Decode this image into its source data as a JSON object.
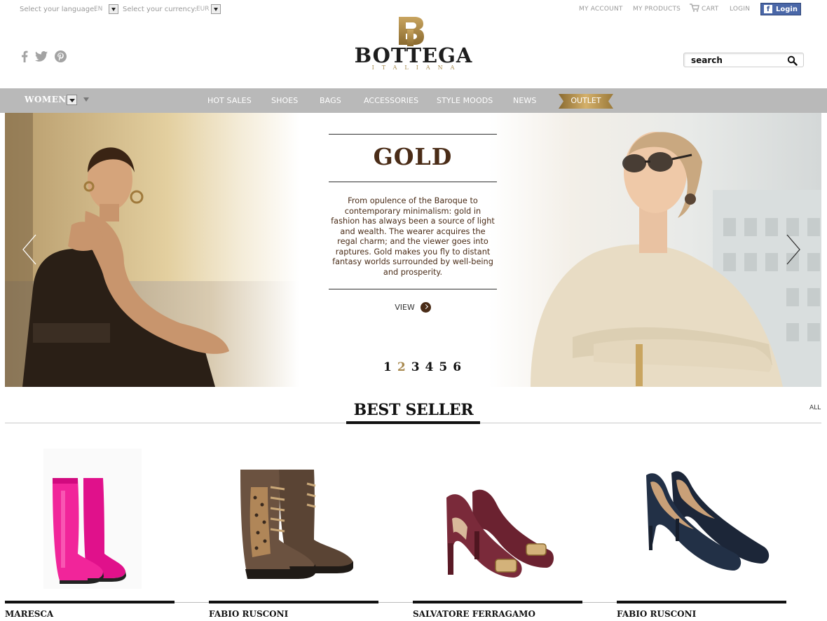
{
  "topbar": {
    "language_label": "Select your language:",
    "language_value": "EN",
    "currency_label": "Select your currency:",
    "currency_value": "EUR",
    "links": [
      "MY ACCOUNT",
      "MY PRODUCTS",
      "CART",
      "LOGIN"
    ],
    "facebook_login": "Login"
  },
  "header": {
    "logo_word": "BOTTEGA",
    "logo_sub": "ITALIANA",
    "search_placeholder": "search"
  },
  "nav": {
    "section": "WOMEN",
    "items": [
      "HOT SALES",
      "SHOES",
      "BAGS",
      "ACCESSORIES",
      "STYLE MOODS",
      "NEWS",
      "OUTLET"
    ]
  },
  "hero": {
    "title": "GOLD",
    "description": "From opulence of the Baroque to contemporary minimalism: gold in fashion has always been a source of light and wealth. The wearer acquires the regal charm; and the viewer goes into raptures. Gold makes you  fly to distant fantasy worlds surrounded by well-being and prosperity.",
    "cta": "VIEW",
    "pages": [
      "1",
      "2",
      "3",
      "4",
      "5",
      "6"
    ],
    "active_page": "2"
  },
  "best_seller": {
    "title": "BEST SELLER",
    "all_link": "ALL",
    "products": [
      {
        "brand": "MARESCA",
        "image": "pink-rain-boots"
      },
      {
        "brand": "FABIO RUSCONI",
        "image": "leopard-lace-up-wedge-boots"
      },
      {
        "brand": "SALVATORE FERRAGAMO",
        "image": "burgundy-buckle-pumps"
      },
      {
        "brand": "FABIO RUSCONI",
        "image": "navy-suede-pumps"
      }
    ]
  },
  "colors": {
    "nav_bg": "#b9b9b9",
    "brand_brown": "#4a2c17",
    "gold": "#a8894f",
    "facebook": "#4a67a8"
  }
}
